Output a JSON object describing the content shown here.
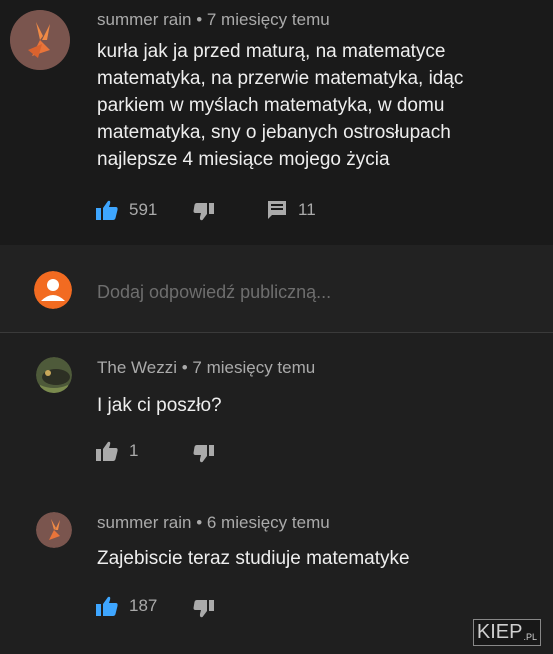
{
  "comments": [
    {
      "author": "summer rain",
      "time": "• 7 miesięcy temu",
      "lines": [
        "kurła jak ja przed maturą, na matematyce",
        "matematyka, na przerwie matematyka, idąc",
        "parkiem w myślach matematyka, w domu",
        "matematyka, sny o jebanych ostrosłupach",
        "najlepsze 4 miesiące mojego życia"
      ],
      "likes": "591",
      "replies": "11"
    },
    {
      "author": "The Wezzi",
      "time": "• 7 miesięcy temu",
      "text": "I jak ci poszło?",
      "likes": "1"
    },
    {
      "author": "summer rain",
      "time": "• 6 miesięcy temu",
      "text": "Zajebiscie teraz studiuje matematyke",
      "likes": "187"
    }
  ],
  "reply_placeholder": "Dodaj odpowiedź publiczną...",
  "watermark": {
    "main": "KIEP",
    "suffix": ".PL"
  },
  "colors": {
    "like_active": "#3ea6ff",
    "text_secondary": "#aaaaaa",
    "reply_avatar_bg": "#f26b21"
  },
  "icons": [
    "thumb-up-icon",
    "thumb-down-icon",
    "reply-icon",
    "user-icon"
  ]
}
